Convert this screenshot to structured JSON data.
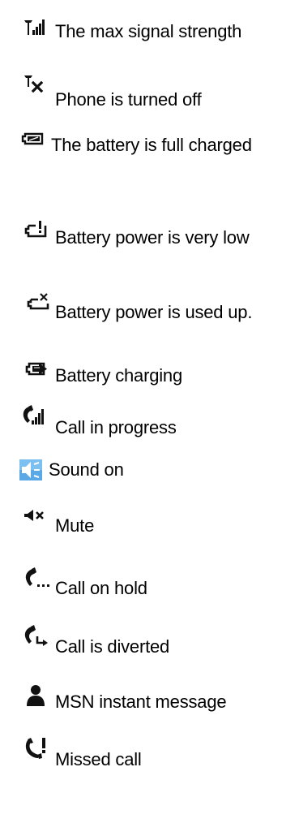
{
  "icon_legend": [
    {
      "icon": "signal-strength-max-icon",
      "label": "The max signal strength"
    },
    {
      "icon": "phone-off-icon",
      "label": "Phone is turned off"
    },
    {
      "icon": "battery-full-icon",
      "label": "The battery is full charged"
    },
    {
      "icon": "battery-very-low-icon",
      "label": "Battery power is very low"
    },
    {
      "icon": "battery-empty-icon",
      "label": "Battery power is used up."
    },
    {
      "icon": "battery-charging-icon",
      "label": "Battery charging"
    },
    {
      "icon": "call-in-progress-icon",
      "label": "Call in progress"
    },
    {
      "icon": "sound-on-icon",
      "label": "Sound on"
    },
    {
      "icon": "mute-icon",
      "label": "Mute"
    },
    {
      "icon": "call-on-hold-icon",
      "label": "Call on hold"
    },
    {
      "icon": "call-diverted-icon",
      "label": "Call is diverted"
    },
    {
      "icon": "msn-instant-message-icon",
      "label": "MSN instant message"
    },
    {
      "icon": "missed-call-icon",
      "label": "Missed call"
    }
  ]
}
